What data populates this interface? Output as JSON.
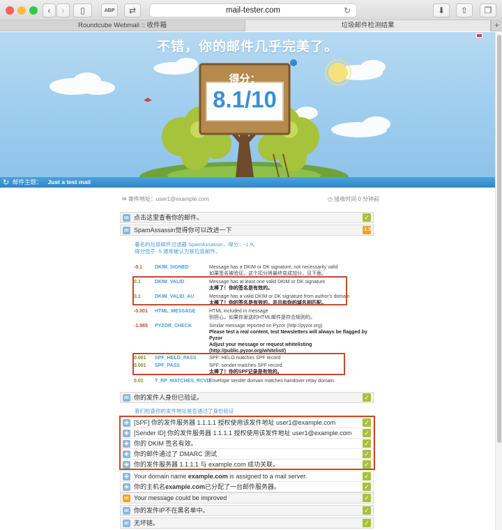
{
  "browser": {
    "url": "mail-tester.com",
    "abp_label": "ABP",
    "tabs": [
      "Roundcube Webmail :: 收件箱",
      "垃圾邮件检测结果"
    ]
  },
  "hero": {
    "title": "不错，你的邮件几乎完美了。",
    "score_label": "得分：",
    "score": "8.1/10"
  },
  "subject": {
    "label": "邮件主题：",
    "value": "Just a test mail"
  },
  "meta": {
    "from": "寄件地址：user1@example.com",
    "received": "接收时间 0 分钟前"
  },
  "rows": {
    "view": "点击这里查看你的邮件。",
    "spamassassin": "SpamAssassin觉得你可以改进一下",
    "spamassassin_score": "-1.9",
    "auth": "你的发件人身份已验证。",
    "improve": "Your message could be improved",
    "blacklist": "你的发件IP不在黑名单中。",
    "links": "无坏链。"
  },
  "sa_note": [
    "著名的垃圾邮件过滤器 SpamAssassin，得分：-1.9。",
    "得分低于 -5 通常被认为是垃圾邮件。"
  ],
  "sa_rules": [
    {
      "score": "-0.1",
      "name": "DKIM_SIGNED",
      "en": "Message has a DKIM or DK signature, not necessarily valid",
      "zh": "如果签名被验证，这个扣分将最终变成加分，见下面。"
    },
    {
      "score": "0.1",
      "name": "DKIM_VALID",
      "en": "Message has at least one valid DKIM or DK signature",
      "zh": "太棒了！你的签名是有效的。"
    },
    {
      "score": "0.1",
      "name": "DKIM_VALID_AU",
      "en": "Message has a valid DKIM or DK signature from author's domain",
      "zh": "太棒了！你的签名是有效的，并且和你的域名相匹配。"
    },
    {
      "score": "-0.001",
      "name": "HTML_MESSAGE",
      "en": "HTML included in message",
      "zh": "别担心，如果你发送的HTML邮件是符合规则的。"
    },
    {
      "score": "-1.985",
      "name": "PYZOR_CHECK",
      "en": "Similar message reported on Pyzor (http://pyzor.org)",
      "zh": "Please test a real content, test Newsletters will always be flagged by Pyzor",
      "zh2": "Adjust your message or request whitelisting (http://public.pyzor.org/whitelist/)"
    },
    {
      "score": "0.001",
      "name": "SPF_HELO_PASS",
      "en": "SPF: HELO matches SPF record",
      "zh": ""
    },
    {
      "score": "0.001",
      "name": "SPF_PASS",
      "en": "SPF: sender matches SPF record",
      "zh": "太棒了！你的SPF记录是有效的。"
    },
    {
      "score": "0.01",
      "name": "T_RP_MATCHES_RCVD",
      "en": "Envelope sender domain matches handover relay domain",
      "zh": ""
    }
  ],
  "auth_note": "我们检查你的发件地址是否通过了身份验证",
  "auth_items": [
    "[SPF] 你的发件服务器 1.1.1.1 授权使用该发件地址 user1@example.com",
    "[Sender ID] 你的发件服务器 1.1.1.1 授权使用该发件地址 user1@example.com",
    "你的 DKIM 签名有效。",
    "你的邮件通过了 DMARC 测试",
    "你的发件服务器 1.1.1.1 与 example.com 成功关联。"
  ],
  "domain_items": [
    {
      "pre": "Your domain name ",
      "bold": "example.com",
      "post": " is assigned to a mail server."
    },
    {
      "pre": "你的主机名",
      "bold": "example.com",
      "post": "已分配了一台邮件服务器。"
    }
  ],
  "colors": {
    "check": "#a7c23b",
    "warn": "#f0a32a",
    "highlight_box": "#c9482d",
    "link": "#4a9ad4"
  }
}
